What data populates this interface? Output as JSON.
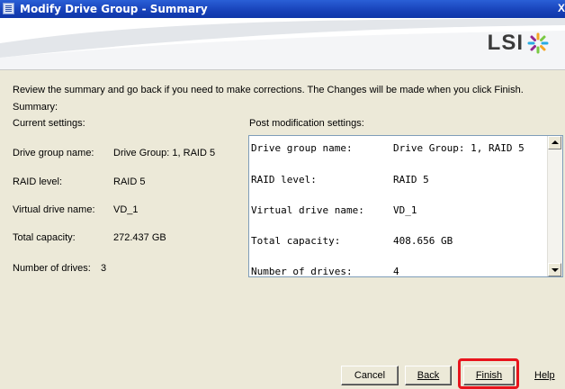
{
  "window": {
    "title": "Modify Drive Group - Summary",
    "close_glyph": "X"
  },
  "banner": {
    "logo_text": "LSI",
    "logo_icon": "lsi-star-icon"
  },
  "intro_text": "Review the summary and go back if you need to make corrections. The Changes will be made when you click Finish.",
  "summary_label": "Summary:",
  "current": {
    "heading": "Current settings:",
    "rows": [
      {
        "key": "Drive group name:",
        "value": "Drive Group: 1, RAID  5"
      },
      {
        "key": "RAID level:",
        "value": "RAID 5"
      },
      {
        "key": "Virtual drive name:",
        "value": "VD_1"
      },
      {
        "key": "Total capacity:",
        "value": "272.437 GB"
      },
      {
        "key": "Number of drives:",
        "value": "3"
      }
    ]
  },
  "post": {
    "heading": "Post modification settings:",
    "rows": [
      {
        "key": "Drive group name:",
        "value": "Drive Group: 1, RAID 5"
      },
      {
        "key": "RAID level:",
        "value": "RAID 5"
      },
      {
        "key": "Virtual drive name:",
        "value": "VD_1"
      },
      {
        "key": "Total capacity:",
        "value": "408.656 GB"
      },
      {
        "key": "Number of drives:",
        "value": "4"
      }
    ]
  },
  "buttons": {
    "cancel": "Cancel",
    "back": "Back",
    "finish": "Finish",
    "help": "Help"
  },
  "colors": {
    "highlight": "#e8141c",
    "titlebar": "#1741b8"
  }
}
